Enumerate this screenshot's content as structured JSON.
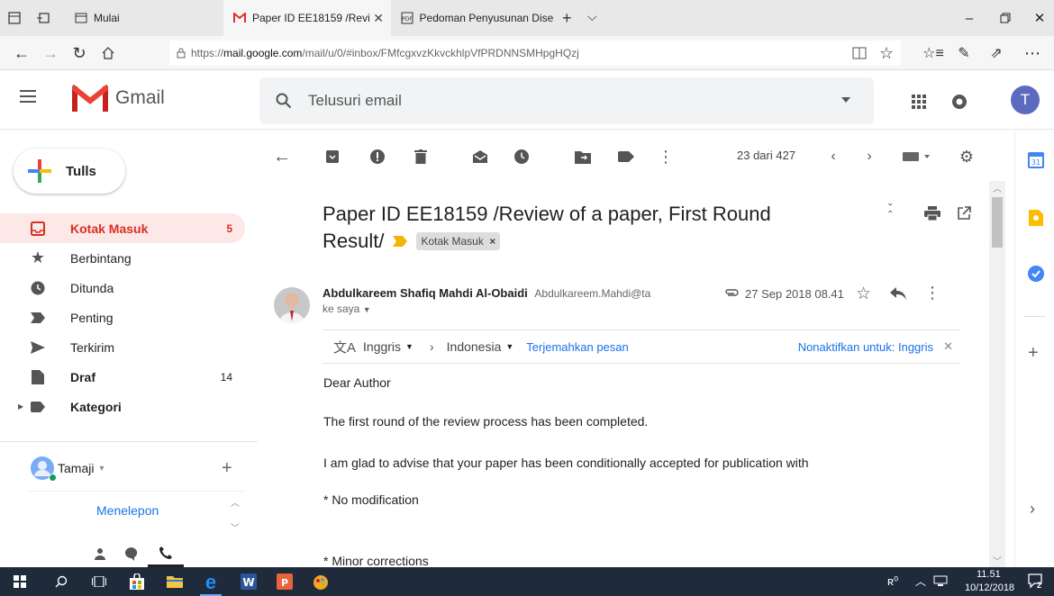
{
  "browser": {
    "tabs": [
      {
        "title": "Mulai"
      },
      {
        "title": "Paper ID EE18159 /Revi"
      },
      {
        "title": "Pedoman Penyusunan Diser"
      }
    ],
    "url_prefix": "https://",
    "url_domain": "mail.google.com",
    "url_path": "/mail/u/0/#inbox/FMfcgxvzKkvckhlpVfPRDNNSMHpgHQzj"
  },
  "gmail": {
    "logo_text": "Gmail",
    "search_placeholder": "Telusuri email",
    "avatar_letter": "T",
    "compose_label": "Tulls"
  },
  "sidebar": {
    "items": [
      {
        "label": "Kotak Masuk",
        "count": "5"
      },
      {
        "label": "Berbintang",
        "count": ""
      },
      {
        "label": "Ditunda",
        "count": ""
      },
      {
        "label": "Penting",
        "count": ""
      },
      {
        "label": "Terkirim",
        "count": ""
      },
      {
        "label": "Draf",
        "count": "14"
      },
      {
        "label": "Kategori",
        "count": ""
      }
    ],
    "user_name": "Tamaji",
    "hangouts_link": "Menelepon"
  },
  "toolbar": {
    "pagination": "23 dari 427"
  },
  "message": {
    "subject_line1": "Paper ID EE18159 /Review of a paper, First Round",
    "subject_line2": "Result/",
    "label_chip": "Kotak Masuk",
    "sender_name": "Abdulkareem Shafiq Mahdi Al-Obaidi",
    "sender_email": "Abdulkareem.Mahdi@ta",
    "date": "27 Sep 2018 08.41",
    "to_line": "ke saya",
    "translate": {
      "from_lang": "Inggris",
      "to_lang": "Indonesia",
      "translate_link": "Terjemahkan pesan",
      "disable_link": "Nonaktifkan untuk: Inggris"
    },
    "body": [
      "Dear Author",
      "The first round of the review process has been completed.",
      "I am glad to advise that your paper has been conditionally accepted for publication with",
      "* No modification",
      "* Minor corrections"
    ]
  },
  "taskbar": {
    "time": "11.51",
    "date": "10/12/2018",
    "notif_count": "2"
  },
  "colors": {
    "accent_red": "#d93025",
    "active_bg": "#fce8e6",
    "link_blue": "#1a73e8",
    "avatar_bg": "#5c6bc0",
    "taskbar_bg": "#1f2a3a"
  }
}
